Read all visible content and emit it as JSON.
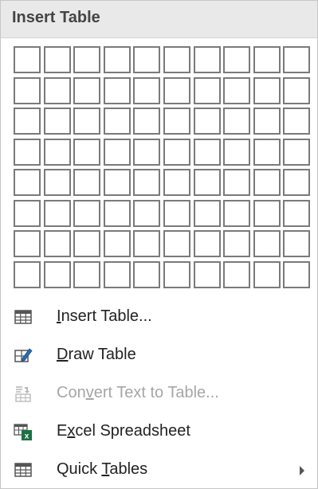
{
  "menu": {
    "title": "Insert Table",
    "grid": {
      "rows": 8,
      "cols": 10
    },
    "items": [
      {
        "pre": "",
        "key": "I",
        "post": "nsert Table...",
        "icon": "table-grid-icon",
        "disabled": false,
        "submenu": false
      },
      {
        "pre": "",
        "key": "D",
        "post": "raw Table",
        "icon": "draw-table-pencil-icon",
        "disabled": false,
        "submenu": false
      },
      {
        "pre": "Con",
        "key": "v",
        "post": "ert Text to Table...",
        "icon": "convert-text-to-table-icon",
        "disabled": true,
        "submenu": false
      },
      {
        "pre": "E",
        "key": "x",
        "post": "cel Spreadsheet",
        "icon": "excel-spreadsheet-icon",
        "disabled": false,
        "submenu": false
      },
      {
        "pre": "Quick ",
        "key": "T",
        "post": "ables",
        "icon": "quick-tables-icon",
        "disabled": false,
        "submenu": true
      }
    ]
  },
  "colors": {
    "grid_border": "#7a7a7a",
    "header_bg": "#e9e9e9",
    "excel_green": "#1e7145",
    "pencil_blue": "#2b6cb0",
    "disabled_text": "#a6a6a6"
  }
}
